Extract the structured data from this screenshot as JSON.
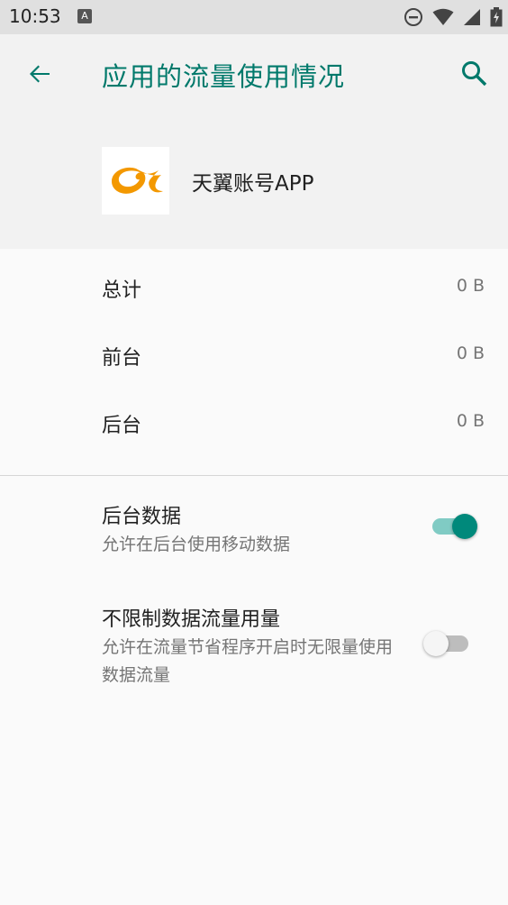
{
  "status_bar": {
    "time": "10:53",
    "notification_icon": "A",
    "icons": [
      "dnd-icon",
      "wifi-icon",
      "signal-icon",
      "battery-icon"
    ]
  },
  "header": {
    "title": "应用的流量使用情况",
    "back_icon": "arrow-back-icon",
    "search_icon": "search-icon"
  },
  "app": {
    "name": "天翼账号APP",
    "logo_icon": "tianyi-logo-icon"
  },
  "usage": [
    {
      "label": "总计",
      "value": "0 B"
    },
    {
      "label": "前台",
      "value": "0 B"
    },
    {
      "label": "后台",
      "value": "0 B"
    }
  ],
  "settings": [
    {
      "title": "后台数据",
      "summary": "允许在后台使用移动数据",
      "enabled": true
    },
    {
      "title": "不限制数据流量用量",
      "summary": "允许在流量节省程序开启时无限量使用数据流量",
      "enabled": false
    }
  ],
  "colors": {
    "accent": "#00796b",
    "switch_on_track": "#80cbc4",
    "switch_on_thumb": "#00897b",
    "switch_off_track": "#bdbdbd",
    "switch_off_thumb": "#f5f5f5",
    "logo_orange": "#f39800"
  }
}
